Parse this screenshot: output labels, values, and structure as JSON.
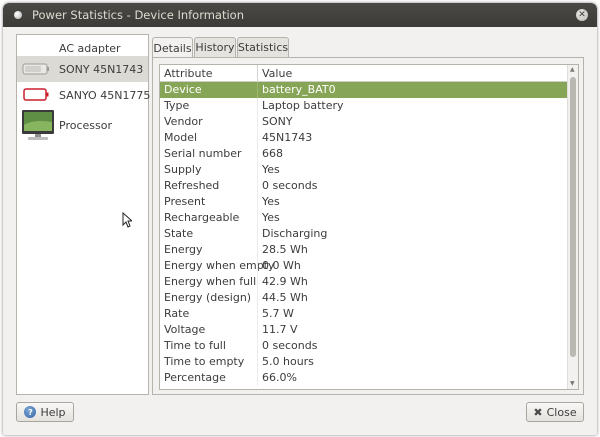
{
  "window": {
    "title": "Power Statistics - Device Information"
  },
  "devices": [
    {
      "label": "AC adapter",
      "icon": "ac-adapter-icon",
      "selected": false
    },
    {
      "label": "SONY 45N1743",
      "icon": "laptop-battery-icon",
      "selected": true
    },
    {
      "label": "SANYO 45N1775",
      "icon": "battery-empty-icon",
      "selected": false
    },
    {
      "label": "Processor",
      "icon": "monitor-icon",
      "selected": false
    }
  ],
  "tabs": [
    {
      "label": "Details",
      "active": true
    },
    {
      "label": "History",
      "active": false
    },
    {
      "label": "Statistics",
      "active": false
    }
  ],
  "table": {
    "headers": [
      "Attribute",
      "Value"
    ],
    "rows": [
      {
        "attribute": "Device",
        "value": "battery_BAT0",
        "selected": true
      },
      {
        "attribute": "Type",
        "value": "Laptop battery"
      },
      {
        "attribute": "Vendor",
        "value": "SONY"
      },
      {
        "attribute": "Model",
        "value": "45N1743"
      },
      {
        "attribute": "Serial number",
        "value": "668"
      },
      {
        "attribute": "Supply",
        "value": "Yes"
      },
      {
        "attribute": "Refreshed",
        "value": "0 seconds"
      },
      {
        "attribute": "Present",
        "value": "Yes"
      },
      {
        "attribute": "Rechargeable",
        "value": "Yes"
      },
      {
        "attribute": "State",
        "value": "Discharging"
      },
      {
        "attribute": "Energy",
        "value": "28.5 Wh"
      },
      {
        "attribute": "Energy when empty",
        "value": "0.0 Wh"
      },
      {
        "attribute": "Energy when full",
        "value": "42.9 Wh"
      },
      {
        "attribute": "Energy (design)",
        "value": "44.5 Wh"
      },
      {
        "attribute": "Rate",
        "value": "5.7 W"
      },
      {
        "attribute": "Voltage",
        "value": "11.7 V"
      },
      {
        "attribute": "Time to full",
        "value": "0 seconds"
      },
      {
        "attribute": "Time to empty",
        "value": "5.0 hours"
      },
      {
        "attribute": "Percentage",
        "value": "66.0%"
      }
    ]
  },
  "buttons": {
    "help_label": "Help",
    "close_label": "Close"
  },
  "colors": {
    "selection": "#87a556",
    "titlebar": "#3c3b37"
  }
}
